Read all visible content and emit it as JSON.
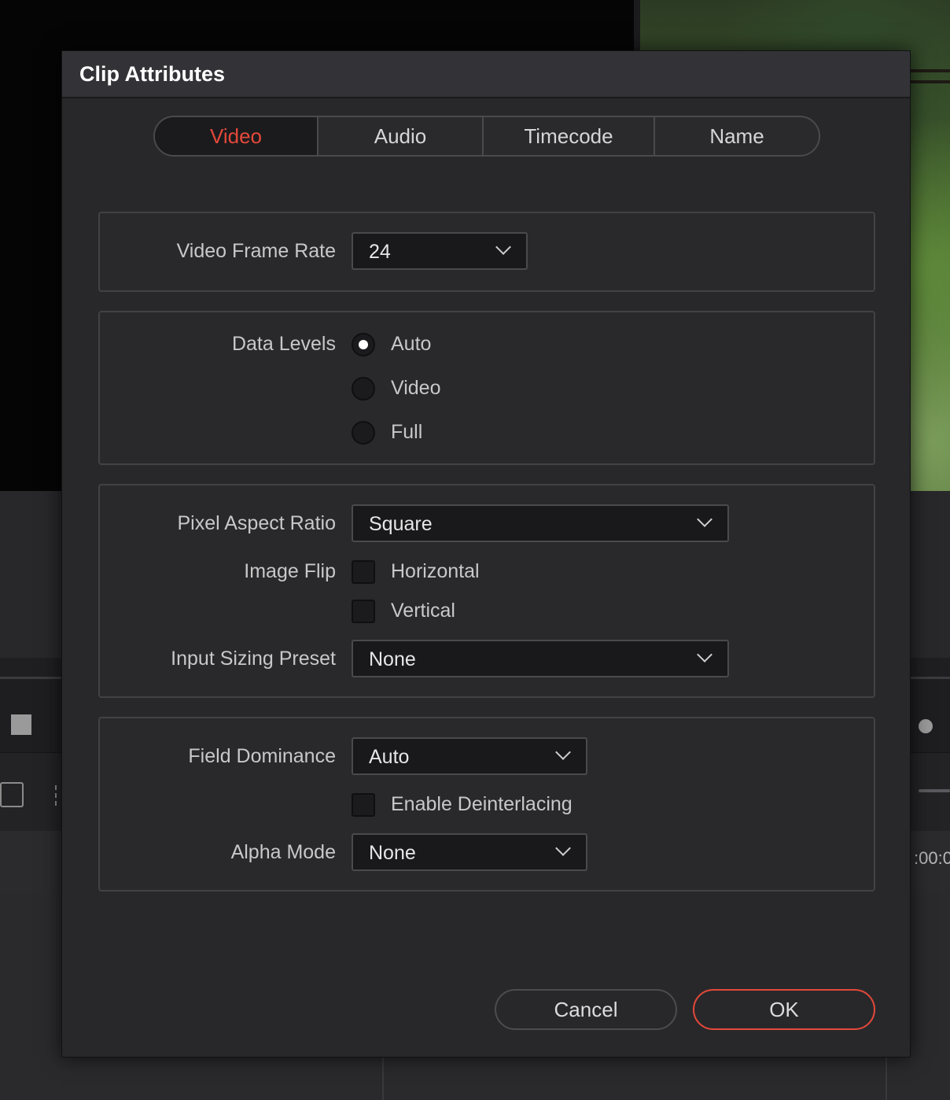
{
  "dialog": {
    "title": "Clip Attributes",
    "tabs": [
      {
        "label": "Video",
        "active": true
      },
      {
        "label": "Audio",
        "active": false
      },
      {
        "label": "Timecode",
        "active": false
      },
      {
        "label": "Name",
        "active": false
      }
    ]
  },
  "frame_rate": {
    "label": "Video Frame Rate",
    "value": "24"
  },
  "data_levels": {
    "label": "Data Levels",
    "options": [
      {
        "label": "Auto",
        "selected": true
      },
      {
        "label": "Video",
        "selected": false
      },
      {
        "label": "Full",
        "selected": false
      }
    ]
  },
  "pixel_aspect": {
    "label": "Pixel Aspect Ratio",
    "value": "Square"
  },
  "image_flip": {
    "label": "Image Flip",
    "horizontal_label": "Horizontal",
    "horizontal_checked": false,
    "vertical_label": "Vertical",
    "vertical_checked": false
  },
  "input_sizing": {
    "label": "Input Sizing Preset",
    "value": "None"
  },
  "field_dominance": {
    "label": "Field Dominance",
    "value": "Auto"
  },
  "deinterlacing": {
    "label": "Enable Deinterlacing",
    "checked": false
  },
  "alpha_mode": {
    "label": "Alpha Mode",
    "value": "None"
  },
  "buttons": {
    "cancel": "Cancel",
    "ok": "OK"
  },
  "background": {
    "timecode_fragment": ":00:0"
  },
  "colors": {
    "accent": "#e4493a",
    "dialog_bg": "#28282b",
    "field_bg": "#19191b"
  }
}
